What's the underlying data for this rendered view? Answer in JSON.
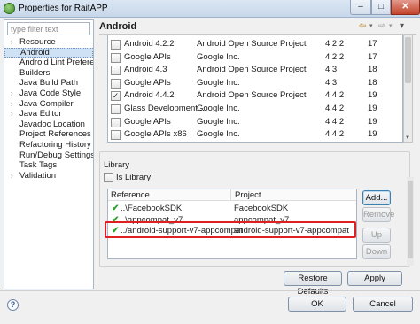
{
  "window": {
    "title": "Properties for RaitAPP",
    "minimize_glyph": "–",
    "maximize_glyph": "□",
    "close_glyph": "✕"
  },
  "sidebar": {
    "filter_placeholder": "type filter text",
    "items": [
      {
        "label": "Resource",
        "expandable": true,
        "selected": false
      },
      {
        "label": "Android",
        "expandable": false,
        "selected": true
      },
      {
        "label": "Android Lint Preferen",
        "expandable": false,
        "selected": false
      },
      {
        "label": "Builders",
        "expandable": false,
        "selected": false
      },
      {
        "label": "Java Build Path",
        "expandable": false,
        "selected": false
      },
      {
        "label": "Java Code Style",
        "expandable": true,
        "selected": false
      },
      {
        "label": "Java Compiler",
        "expandable": true,
        "selected": false
      },
      {
        "label": "Java Editor",
        "expandable": true,
        "selected": false
      },
      {
        "label": "Javadoc Location",
        "expandable": false,
        "selected": false
      },
      {
        "label": "Project References",
        "expandable": false,
        "selected": false
      },
      {
        "label": "Refactoring History",
        "expandable": false,
        "selected": false
      },
      {
        "label": "Run/Debug Settings",
        "expandable": false,
        "selected": false
      },
      {
        "label": "Task Tags",
        "expandable": false,
        "selected": false
      },
      {
        "label": "Validation",
        "expandable": true,
        "selected": false
      }
    ]
  },
  "page": {
    "title": "Android",
    "nav": {
      "back": "⇦",
      "dropdown": "▾",
      "forward": "⇨",
      "menu": "▾"
    }
  },
  "targets": {
    "rows": [
      {
        "name": "Android 4.2.2",
        "vendor": "Android Open Source Project",
        "platform": "4.2.2",
        "api": "17",
        "checked": false
      },
      {
        "name": "Google APIs",
        "vendor": "Google Inc.",
        "platform": "4.2.2",
        "api": "17",
        "checked": false
      },
      {
        "name": "Android 4.3",
        "vendor": "Android Open Source Project",
        "platform": "4.3",
        "api": "18",
        "checked": false
      },
      {
        "name": "Google APIs",
        "vendor": "Google Inc.",
        "platform": "4.3",
        "api": "18",
        "checked": false
      },
      {
        "name": "Android 4.4.2",
        "vendor": "Android Open Source Project",
        "platform": "4.4.2",
        "api": "19",
        "checked": true
      },
      {
        "name": "Glass Development ...",
        "vendor": "Google Inc.",
        "platform": "4.4.2",
        "api": "19",
        "checked": false
      },
      {
        "name": "Google APIs",
        "vendor": "Google Inc.",
        "platform": "4.4.2",
        "api": "19",
        "checked": false
      },
      {
        "name": "Google APIs x86",
        "vendor": "Google Inc.",
        "platform": "4.4.2",
        "api": "19",
        "checked": false
      }
    ]
  },
  "library": {
    "title": "Library",
    "is_library_label": "Is Library",
    "is_library_checked": false,
    "columns": {
      "reference": "Reference",
      "project": "Project"
    },
    "references": [
      {
        "reference": "..\\FacebookSDK",
        "project": "FacebookSDK"
      },
      {
        "reference": "..\\appcompat_v7",
        "project": "appcompat_v7"
      },
      {
        "reference": "../android-support-v7-appcompat",
        "project": "android-support-v7-appcompat"
      }
    ],
    "buttons": {
      "add": "Add...",
      "remove": "Remove",
      "up": "Up",
      "down": "Down"
    }
  },
  "actions": {
    "restore_defaults": "Restore Defaults",
    "apply": "Apply",
    "ok": "OK",
    "cancel": "Cancel"
  },
  "icons": {
    "app": "eclipse-sphere-icon",
    "check": "green-check-icon",
    "help": "help-icon"
  },
  "colors": {
    "highlight_border": "#e02020",
    "selection": "#cfe1f5",
    "check_green": "#2ea02e"
  }
}
